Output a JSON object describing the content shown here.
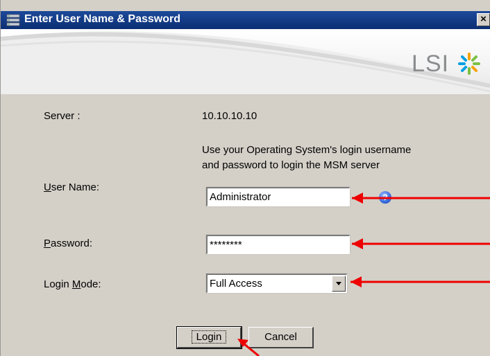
{
  "window": {
    "title": "Enter User Name & Password",
    "close_glyph": "×"
  },
  "banner": {
    "logo_text": "LSI",
    "logo_icon": "lsi-starburst-icon"
  },
  "form": {
    "server_label": "Server :",
    "server_value": "10.10.10.10",
    "instructions_line1": "Use your Operating System's login username",
    "instructions_line2": "and password to login the MSM server",
    "username_label_access_key": "U",
    "username_label_rest": "ser Name:",
    "username_value": "Administrator",
    "help_glyph": "?",
    "password_label_access_key": "P",
    "password_label_rest": "assword:",
    "password_value": "********",
    "login_mode_label_prefix": "Login ",
    "login_mode_label_access_key": "M",
    "login_mode_label_rest": "ode:",
    "login_mode_value": "Full Access"
  },
  "buttons": {
    "login_label": "Login",
    "cancel_label": "Cancel"
  },
  "colors": {
    "titlebar": "#0b2e73",
    "dialog_bg": "#d4d0c8",
    "annotation_arrow": "#ee0000"
  }
}
